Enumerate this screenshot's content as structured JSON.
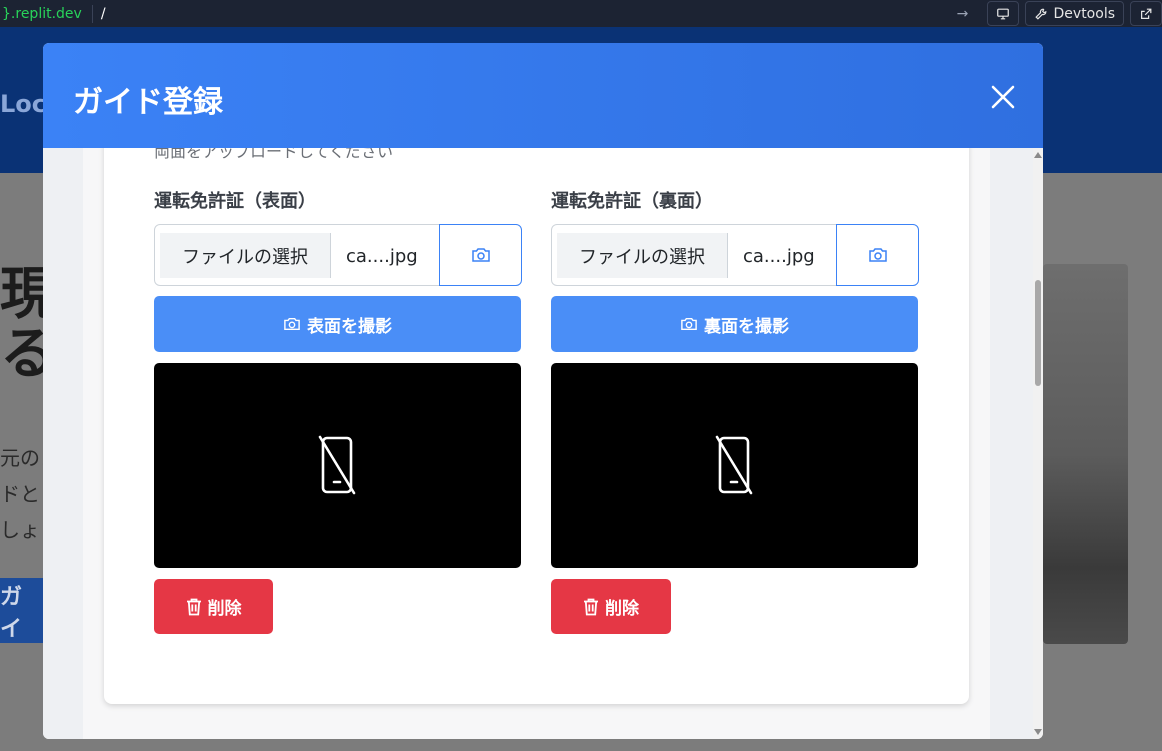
{
  "browser": {
    "url_brace": "}",
    "url_host": ".replit.dev",
    "url_path": "/",
    "devtools_label": "Devtools"
  },
  "background": {
    "logo_fragment": "Loc",
    "hero_fragment_1": "現地",
    "hero_fragment_2": "る、",
    "sub_fragment_1": "元のノ",
    "sub_fragment_2": "ドと",
    "sub_fragment_3": "しょう",
    "button_fragment": "ガイ"
  },
  "modal": {
    "title": "ガイド登録",
    "hint": "両面をアップロードしてください",
    "front": {
      "label": "運転免許証（表面）",
      "choose_file": "ファイルの選択",
      "file_name": "ca....jpg",
      "shoot_label": "表面を撮影",
      "delete_label": "削除"
    },
    "back": {
      "label": "運転免許証（裏面）",
      "choose_file": "ファイルの選択",
      "file_name": "ca....jpg",
      "shoot_label": "裏面を撮影",
      "delete_label": "削除"
    }
  },
  "colors": {
    "header_blue": "#3b82f6",
    "primary_button": "#4a8ef7",
    "danger_button": "#e53745"
  }
}
